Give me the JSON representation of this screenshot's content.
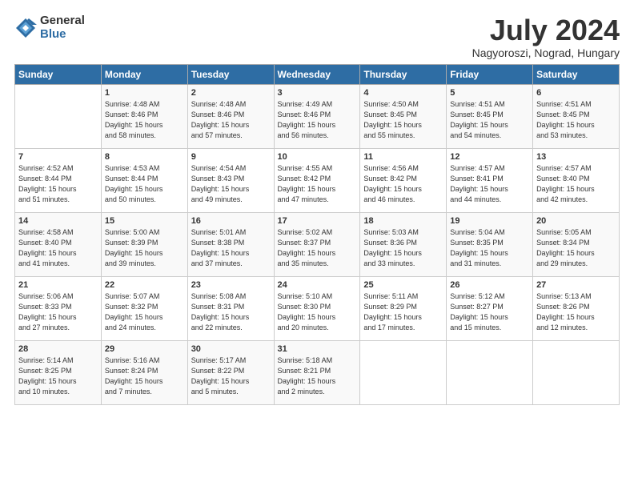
{
  "logo": {
    "general": "General",
    "blue": "Blue"
  },
  "title": "July 2024",
  "location": "Nagyoroszi, Nograd, Hungary",
  "headers": [
    "Sunday",
    "Monday",
    "Tuesday",
    "Wednesday",
    "Thursday",
    "Friday",
    "Saturday"
  ],
  "weeks": [
    [
      {
        "day": "",
        "info": ""
      },
      {
        "day": "1",
        "info": "Sunrise: 4:48 AM\nSunset: 8:46 PM\nDaylight: 15 hours\nand 58 minutes."
      },
      {
        "day": "2",
        "info": "Sunrise: 4:48 AM\nSunset: 8:46 PM\nDaylight: 15 hours\nand 57 minutes."
      },
      {
        "day": "3",
        "info": "Sunrise: 4:49 AM\nSunset: 8:46 PM\nDaylight: 15 hours\nand 56 minutes."
      },
      {
        "day": "4",
        "info": "Sunrise: 4:50 AM\nSunset: 8:45 PM\nDaylight: 15 hours\nand 55 minutes."
      },
      {
        "day": "5",
        "info": "Sunrise: 4:51 AM\nSunset: 8:45 PM\nDaylight: 15 hours\nand 54 minutes."
      },
      {
        "day": "6",
        "info": "Sunrise: 4:51 AM\nSunset: 8:45 PM\nDaylight: 15 hours\nand 53 minutes."
      }
    ],
    [
      {
        "day": "7",
        "info": "Sunrise: 4:52 AM\nSunset: 8:44 PM\nDaylight: 15 hours\nand 51 minutes."
      },
      {
        "day": "8",
        "info": "Sunrise: 4:53 AM\nSunset: 8:44 PM\nDaylight: 15 hours\nand 50 minutes."
      },
      {
        "day": "9",
        "info": "Sunrise: 4:54 AM\nSunset: 8:43 PM\nDaylight: 15 hours\nand 49 minutes."
      },
      {
        "day": "10",
        "info": "Sunrise: 4:55 AM\nSunset: 8:42 PM\nDaylight: 15 hours\nand 47 minutes."
      },
      {
        "day": "11",
        "info": "Sunrise: 4:56 AM\nSunset: 8:42 PM\nDaylight: 15 hours\nand 46 minutes."
      },
      {
        "day": "12",
        "info": "Sunrise: 4:57 AM\nSunset: 8:41 PM\nDaylight: 15 hours\nand 44 minutes."
      },
      {
        "day": "13",
        "info": "Sunrise: 4:57 AM\nSunset: 8:40 PM\nDaylight: 15 hours\nand 42 minutes."
      }
    ],
    [
      {
        "day": "14",
        "info": "Sunrise: 4:58 AM\nSunset: 8:40 PM\nDaylight: 15 hours\nand 41 minutes."
      },
      {
        "day": "15",
        "info": "Sunrise: 5:00 AM\nSunset: 8:39 PM\nDaylight: 15 hours\nand 39 minutes."
      },
      {
        "day": "16",
        "info": "Sunrise: 5:01 AM\nSunset: 8:38 PM\nDaylight: 15 hours\nand 37 minutes."
      },
      {
        "day": "17",
        "info": "Sunrise: 5:02 AM\nSunset: 8:37 PM\nDaylight: 15 hours\nand 35 minutes."
      },
      {
        "day": "18",
        "info": "Sunrise: 5:03 AM\nSunset: 8:36 PM\nDaylight: 15 hours\nand 33 minutes."
      },
      {
        "day": "19",
        "info": "Sunrise: 5:04 AM\nSunset: 8:35 PM\nDaylight: 15 hours\nand 31 minutes."
      },
      {
        "day": "20",
        "info": "Sunrise: 5:05 AM\nSunset: 8:34 PM\nDaylight: 15 hours\nand 29 minutes."
      }
    ],
    [
      {
        "day": "21",
        "info": "Sunrise: 5:06 AM\nSunset: 8:33 PM\nDaylight: 15 hours\nand 27 minutes."
      },
      {
        "day": "22",
        "info": "Sunrise: 5:07 AM\nSunset: 8:32 PM\nDaylight: 15 hours\nand 24 minutes."
      },
      {
        "day": "23",
        "info": "Sunrise: 5:08 AM\nSunset: 8:31 PM\nDaylight: 15 hours\nand 22 minutes."
      },
      {
        "day": "24",
        "info": "Sunrise: 5:10 AM\nSunset: 8:30 PM\nDaylight: 15 hours\nand 20 minutes."
      },
      {
        "day": "25",
        "info": "Sunrise: 5:11 AM\nSunset: 8:29 PM\nDaylight: 15 hours\nand 17 minutes."
      },
      {
        "day": "26",
        "info": "Sunrise: 5:12 AM\nSunset: 8:27 PM\nDaylight: 15 hours\nand 15 minutes."
      },
      {
        "day": "27",
        "info": "Sunrise: 5:13 AM\nSunset: 8:26 PM\nDaylight: 15 hours\nand 12 minutes."
      }
    ],
    [
      {
        "day": "28",
        "info": "Sunrise: 5:14 AM\nSunset: 8:25 PM\nDaylight: 15 hours\nand 10 minutes."
      },
      {
        "day": "29",
        "info": "Sunrise: 5:16 AM\nSunset: 8:24 PM\nDaylight: 15 hours\nand 7 minutes."
      },
      {
        "day": "30",
        "info": "Sunrise: 5:17 AM\nSunset: 8:22 PM\nDaylight: 15 hours\nand 5 minutes."
      },
      {
        "day": "31",
        "info": "Sunrise: 5:18 AM\nSunset: 8:21 PM\nDaylight: 15 hours\nand 2 minutes."
      },
      {
        "day": "",
        "info": ""
      },
      {
        "day": "",
        "info": ""
      },
      {
        "day": "",
        "info": ""
      }
    ]
  ]
}
